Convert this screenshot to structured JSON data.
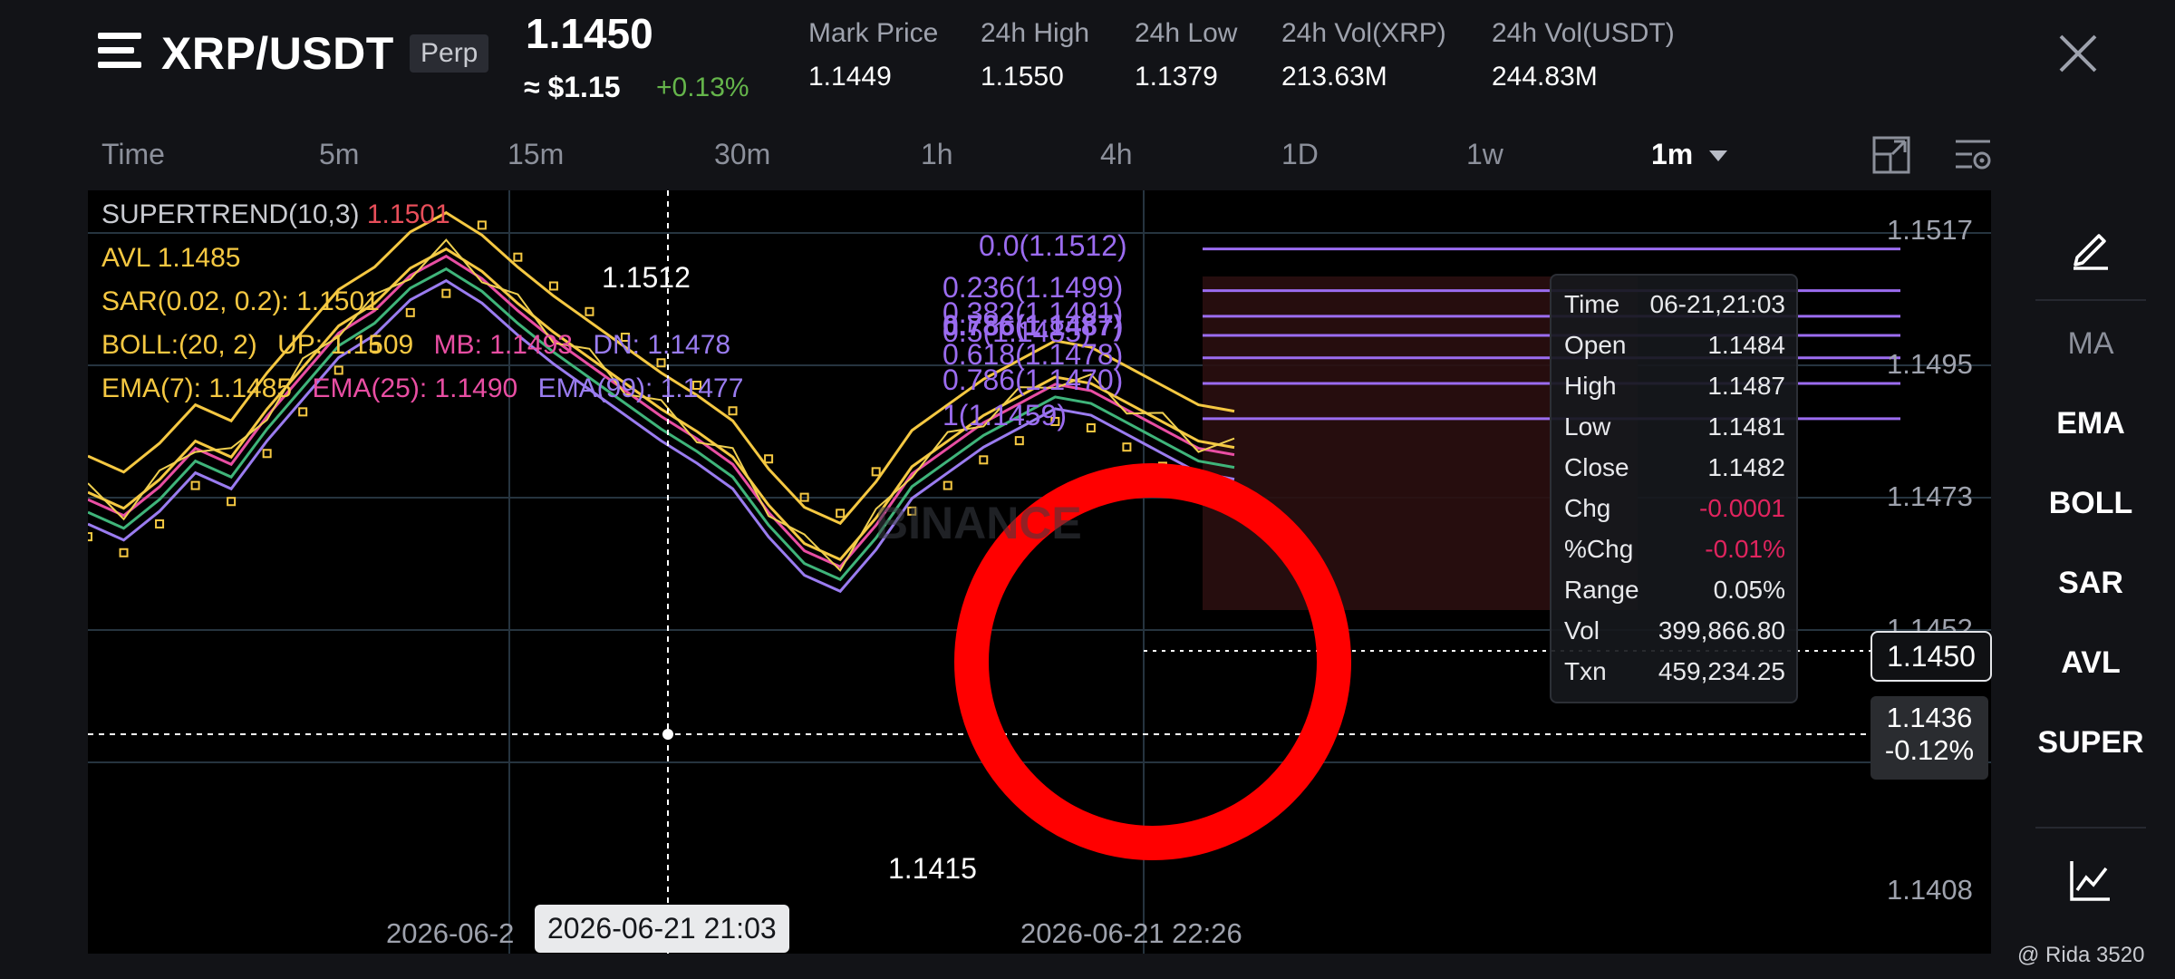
{
  "header": {
    "symbol": "XRP/USDT",
    "contract_badge": "Perp",
    "last_price": "1.1450",
    "usd_approx": "≈ $1.15",
    "change_pct": "+0.13%",
    "stats": [
      {
        "label": "Mark Price",
        "value": "1.1449"
      },
      {
        "label": "24h High",
        "value": "1.1550"
      },
      {
        "label": "24h Low",
        "value": "1.1379"
      },
      {
        "label": "24h Vol(XRP)",
        "value": "213.63M"
      },
      {
        "label": "24h Vol(USDT)",
        "value": "244.83M"
      }
    ]
  },
  "intervals": [
    "Time",
    "5m",
    "15m",
    "30m",
    "1h",
    "4h",
    "1D",
    "1w",
    "1m"
  ],
  "active_interval": "1m",
  "indicators": {
    "supertrend_label": "SUPERTREND(10,3)",
    "supertrend_value": "1.1501",
    "avl": "AVL 1.1485",
    "sar": "SAR(0.02, 0.2): 1.1501",
    "boll_label": "BOLL:(20, 2)",
    "boll_up": "UP: 1.1509",
    "boll_mb": "MB: 1.1493",
    "boll_dn": "DN: 1.1478",
    "ema7": "EMA(7): 1.1485",
    "ema25": "EMA(25): 1.1490",
    "ema99": "EMA(99): 1.1477"
  },
  "fib_levels": [
    {
      "label": "0.0(1.1512)",
      "price": 1.1512
    },
    {
      "label": "0.236(1.1499)",
      "price": 1.1499
    },
    {
      "label": "0.382(1.1491)",
      "price": 1.1491
    },
    {
      "label": "0.5(1.1485)",
      "price": 1.1485
    },
    {
      "label": "0.618(1.1478)",
      "price": 1.1478
    },
    {
      "label": "0.786(1.1470)",
      "price": 1.147
    },
    {
      "label": "1(1.1459)",
      "price": 1.1459
    }
  ],
  "fib_overlap_label": "0.786(1.1487)",
  "y_axis": [
    "1.1517",
    "1.1495",
    "1.1473",
    "1.1452",
    "1.1408"
  ],
  "current_price_tag": "1.1450",
  "crosshair_price": "1.1436",
  "crosshair_pct": "-0.12%",
  "high_marker": "1.1512",
  "low_marker": "1.1415",
  "x_axis": [
    "2026-06-2",
    "2026-06-21 22:26"
  ],
  "crosshair_time": "2026-06-21 21:03",
  "tooltip": [
    {
      "k": "Time",
      "v": "06-21,21:03"
    },
    {
      "k": "Open",
      "v": "1.1484"
    },
    {
      "k": "High",
      "v": "1.1487"
    },
    {
      "k": "Low",
      "v": "1.1481"
    },
    {
      "k": "Close",
      "v": "1.1482"
    },
    {
      "k": "Chg",
      "v": "-0.0001"
    },
    {
      "k": "%Chg",
      "v": "-0.01%"
    },
    {
      "k": "Range",
      "v": "0.05%"
    },
    {
      "k": "Vol",
      "v": "399,866.80"
    },
    {
      "k": "Txn",
      "v": "459,234.25"
    }
  ],
  "watermark_logo": "BINANCE",
  "sidebar": {
    "edit_icon": "pencil-icon",
    "ma": "MA",
    "items": [
      "EMA",
      "BOLL",
      "SAR",
      "AVL",
      "SUPER"
    ],
    "chart_icon": "line-chart-icon"
  },
  "credit": "@ Rida 3520",
  "colors": {
    "up": "#65b54b",
    "down": "#e0245e",
    "fib": "#9b6cf0",
    "fib_zone": "#2a0e10",
    "annotation_circle": "#ff0000",
    "supertrend": "#e84e5a",
    "ema7": "#f5c842",
    "ema25": "#e94ea3",
    "ema99": "#9a7cf0"
  }
}
